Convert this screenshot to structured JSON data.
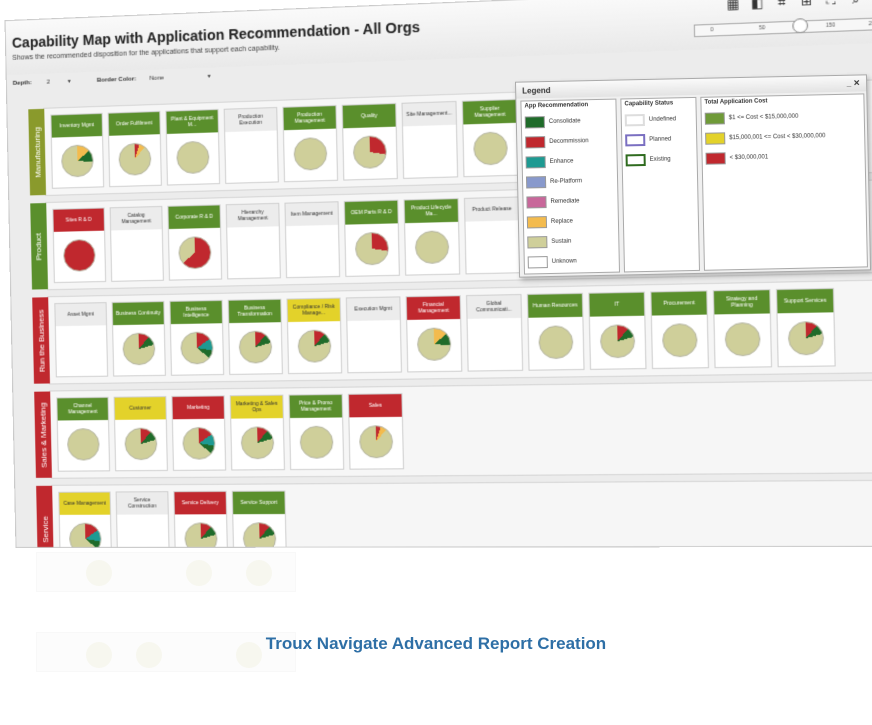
{
  "window": {
    "title": "Capability Map with Application Recommendation - All Orgs",
    "subtitle": "Shows the recommended disposition for the applications that support each capability.",
    "tool_icons": [
      "grid-icon",
      "window-icon",
      "frame-icon",
      "expand-icon",
      "fullscreen-icon",
      "search-icon",
      "hand-icon",
      "print-icon"
    ],
    "zoom_ticks": [
      "0",
      "50",
      "150",
      "200"
    ]
  },
  "filters": {
    "depth_label": "Depth:",
    "depth_value": "2",
    "border_label": "Border Color:",
    "border_value": "None"
  },
  "rows": [
    {
      "label": "Manufacturing",
      "color": "#8a9a2c",
      "caps": [
        {
          "name": "Inventory Mgmt",
          "color": "#5a8f2c",
          "pie": "yellow"
        },
        {
          "name": "Order Fulfilment",
          "color": "#5a8f2c",
          "pie": "small"
        },
        {
          "name": "Plant & Equipment M...",
          "color": "#5a8f2c",
          "pie": "plain"
        },
        {
          "name": "Production Execution",
          "color": "#ececec",
          "pie": "none"
        },
        {
          "name": "Production Management",
          "color": "#5a8f2c",
          "pie": "plain"
        },
        {
          "name": "Quality",
          "color": "#5a8f2c",
          "pie": "red"
        },
        {
          "name": "Site Management...",
          "color": "#ececec",
          "pie": "none"
        },
        {
          "name": "Supplier Management",
          "color": "#5a8f2c",
          "pie": "plain"
        }
      ]
    },
    {
      "label": "Product",
      "color": "#5a8f2c",
      "caps": [
        {
          "name": "Sites R & D",
          "color": "#c0282e",
          "pie": "full-red"
        },
        {
          "name": "Catalog Management",
          "color": "#ececec",
          "pie": "none"
        },
        {
          "name": "Corporate R & D",
          "color": "#5a8f2c",
          "pie": "big-red"
        },
        {
          "name": "Hierarchy Management",
          "color": "#ececec",
          "pie": "none"
        },
        {
          "name": "Item Management",
          "color": "#ececec",
          "pie": "none"
        },
        {
          "name": "OEM Parts R & D",
          "color": "#5a8f2c",
          "pie": "red"
        },
        {
          "name": "Product Lifecycle Ma...",
          "color": "#5a8f2c",
          "pie": "plain"
        },
        {
          "name": "Product Release",
          "color": "#ececec",
          "pie": "none"
        }
      ]
    },
    {
      "label": "Run the Business",
      "color": "#c0282e",
      "caps": [
        {
          "name": "Asset Mgmt",
          "color": "#ececec",
          "pie": "none"
        },
        {
          "name": "Business Continuity",
          "color": "#5a8f2c",
          "pie": "mix"
        },
        {
          "name": "Business Intelligence",
          "color": "#5a8f2c",
          "pie": "mix2"
        },
        {
          "name": "Business Transformation",
          "color": "#5a8f2c",
          "pie": "mix"
        },
        {
          "name": "Compliance / Risk Manage...",
          "color": "#e3d22a",
          "pie": "mix"
        },
        {
          "name": "Execution Mgmt",
          "color": "#ececec",
          "pie": "none"
        },
        {
          "name": "Financial Management",
          "color": "#c0282e",
          "pie": "yellow"
        },
        {
          "name": "Global Communicati...",
          "color": "#ececec",
          "pie": "none"
        },
        {
          "name": "Human Resources",
          "color": "#5a8f2c",
          "pie": "plain"
        },
        {
          "name": "IT",
          "color": "#5a8f2c",
          "pie": "mix"
        },
        {
          "name": "Procurement",
          "color": "#5a8f2c",
          "pie": "plain"
        },
        {
          "name": "Strategy and Planning",
          "color": "#5a8f2c",
          "pie": "plain"
        },
        {
          "name": "Support Services",
          "color": "#5a8f2c",
          "pie": "mix"
        }
      ]
    },
    {
      "label": "Sales & Marketing",
      "color": "#c0282e",
      "caps": [
        {
          "name": "Channel Management",
          "color": "#5a8f2c",
          "pie": "plain"
        },
        {
          "name": "Customer",
          "color": "#e3d22a",
          "pie": "mix"
        },
        {
          "name": "Marketing",
          "color": "#c0282e",
          "pie": "mix2"
        },
        {
          "name": "Marketing & Sales Ops",
          "color": "#e3d22a",
          "pie": "mix"
        },
        {
          "name": "Price & Promo Management",
          "color": "#5a8f2c",
          "pie": "plain"
        },
        {
          "name": "Sales",
          "color": "#c0282e",
          "pie": "small"
        }
      ]
    },
    {
      "label": "Service",
      "color": "#c0282e",
      "caps": [
        {
          "name": "Case Management",
          "color": "#e3d22a",
          "pie": "mix2"
        },
        {
          "name": "Service Construction",
          "color": "#ececec",
          "pie": "none"
        },
        {
          "name": "Service Delivery",
          "color": "#c0282e",
          "pie": "mix"
        },
        {
          "name": "Service Support",
          "color": "#5a8f2c",
          "pie": "mix"
        }
      ]
    }
  ],
  "legend": {
    "title": "Legend",
    "rec_title": "App Recommendation",
    "rec_items": [
      {
        "label": "Consolidate",
        "color": "#1f6b2a"
      },
      {
        "label": "Decommission",
        "color": "#c0282e"
      },
      {
        "label": "Enhance",
        "color": "#1e9a92"
      },
      {
        "label": "Re-Platform",
        "color": "#8899cc"
      },
      {
        "label": "Remediate",
        "color": "#c8679a"
      },
      {
        "label": "Replace",
        "color": "#f3bb4e"
      },
      {
        "label": "Sustain",
        "color": "#cfcf9a"
      },
      {
        "label": "Unknown",
        "color": "#ffffff"
      }
    ],
    "status_title": "Capability Status",
    "status_items": [
      {
        "label": "Undefined",
        "color": "#ffffff",
        "border": "#dddddd"
      },
      {
        "label": "Planned",
        "color": "#ffffff",
        "border": "#7a6fc1"
      },
      {
        "label": "Existing",
        "color": "#ffffff",
        "border": "#2f6b1f"
      }
    ],
    "cost_title": "Total Application Cost",
    "cost_items": [
      {
        "label": "$1 <= Cost < $15,000,000",
        "color": "#6f9a38"
      },
      {
        "label": "$15,000,001 <= Cost < $30,000,000",
        "color": "#e3d22a"
      },
      {
        "label": "< $30,000,001",
        "color": "#c0282e"
      }
    ]
  },
  "footer": {
    "caption": "Troux Navigate Advanced Report Creation"
  }
}
